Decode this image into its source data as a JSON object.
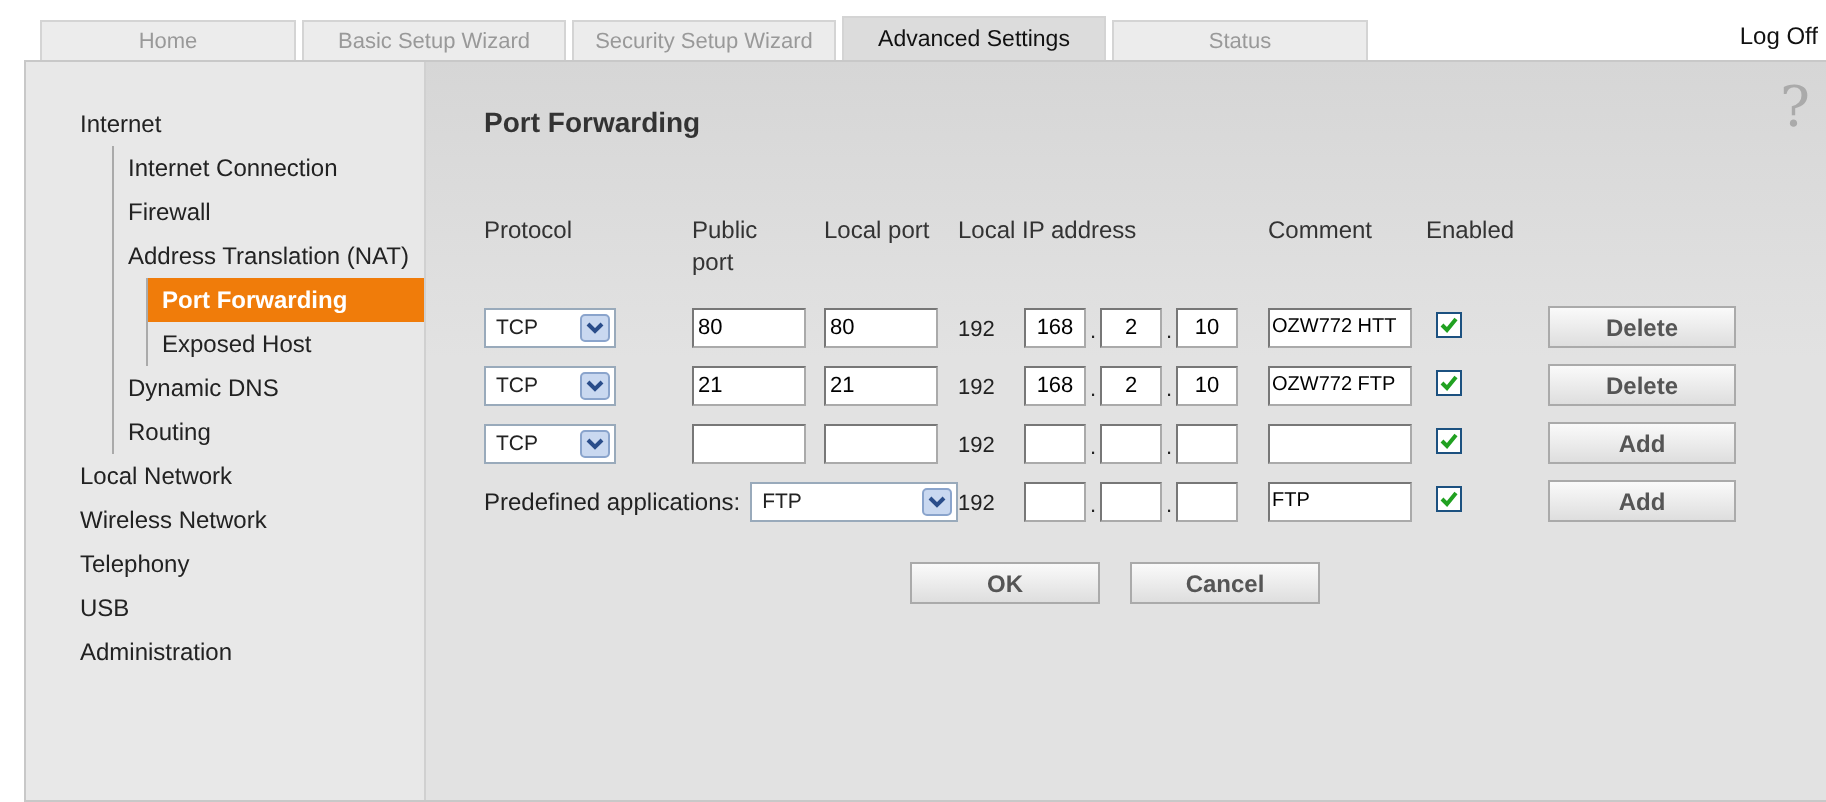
{
  "tabs": [
    {
      "label": "Home",
      "selected": false
    },
    {
      "label": "Basic Setup Wizard",
      "selected": false
    },
    {
      "label": "Security Setup Wizard",
      "selected": false
    },
    {
      "label": "Advanced Settings",
      "selected": true
    },
    {
      "label": "Status",
      "selected": false
    }
  ],
  "log_off": "Log Off",
  "help": "?",
  "sidebar": {
    "items": [
      {
        "label": "Internet",
        "selected": false,
        "children": [
          {
            "label": "Internet Connection",
            "selected": false
          },
          {
            "label": "Firewall",
            "selected": false
          },
          {
            "label": "Address Translation (NAT)",
            "selected": false,
            "children": [
              {
                "label": "Port Forwarding",
                "selected": true
              },
              {
                "label": "Exposed Host",
                "selected": false
              }
            ]
          },
          {
            "label": "Dynamic DNS",
            "selected": false
          },
          {
            "label": "Routing",
            "selected": false
          }
        ]
      },
      {
        "label": "Local Network",
        "selected": false
      },
      {
        "label": "Wireless Network",
        "selected": false
      },
      {
        "label": "Telephony",
        "selected": false
      },
      {
        "label": "USB",
        "selected": false
      },
      {
        "label": "Administration",
        "selected": false
      }
    ]
  },
  "page_title": "Port Forwarding",
  "columns": [
    "Protocol",
    "Public port",
    "Local port",
    "Local IP address",
    "Comment",
    "Enabled"
  ],
  "rows": [
    {
      "kind": "rule",
      "protocol": "TCP",
      "public_port": "80",
      "local_port": "80",
      "ip_prefix": "192",
      "ip_separators": [
        ".",
        "."
      ],
      "ip_octets": [
        "168",
        "2",
        "10"
      ],
      "comment": "OZW772 HTT",
      "enabled": true,
      "button": "Delete"
    },
    {
      "kind": "rule",
      "protocol": "TCP",
      "public_port": "21",
      "local_port": "21",
      "ip_prefix": "192",
      "ip_separators": [
        ".",
        "."
      ],
      "ip_octets": [
        "168",
        "2",
        "10"
      ],
      "comment": "OZW772 FTP",
      "enabled": true,
      "button": "Delete"
    },
    {
      "kind": "rule",
      "protocol": "TCP",
      "ip_prefix": "192",
      "ip_separators": [
        ".",
        "."
      ],
      "enabled": true,
      "button": "Add"
    },
    {
      "kind": "predefined",
      "label": "Predefined applications:",
      "application": "FTP",
      "ip_prefix": "192",
      "ip_separators": [
        ".",
        "."
      ],
      "comment": "FTP",
      "enabled": true,
      "button": "Add"
    }
  ],
  "buttons": [
    "OK",
    "Cancel"
  ]
}
